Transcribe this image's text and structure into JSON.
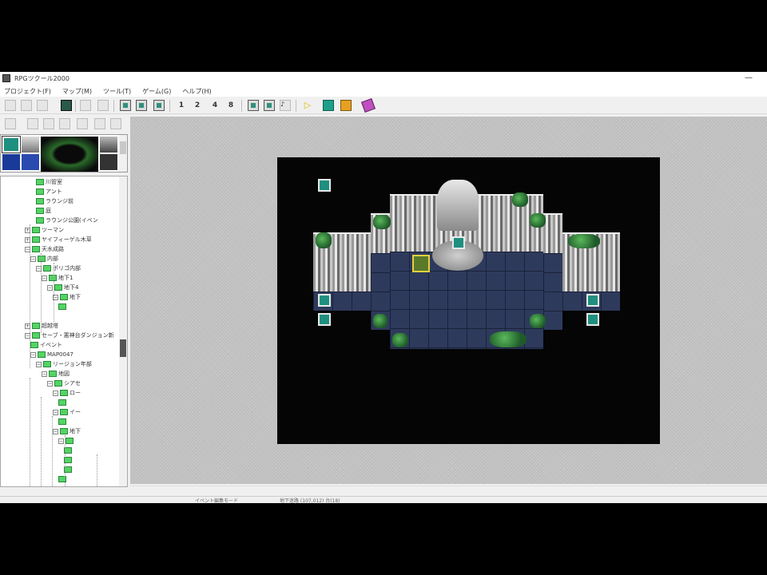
{
  "window": {
    "title": "RPGツクール2000"
  },
  "menu": [
    "プロジェクト(F)",
    "マップ(M)",
    "ツール(T)",
    "ゲーム(G)",
    "ヘルプ(H)"
  ],
  "toolbar": {
    "layer_labels": [
      "1",
      "2",
      "4",
      "8"
    ]
  },
  "tree": {
    "items": [
      {
        "label": "川管室",
        "indent": 4,
        "expand": ""
      },
      {
        "label": "アント",
        "indent": 4,
        "expand": ""
      },
      {
        "label": "ラウンジ前",
        "indent": 4,
        "expand": ""
      },
      {
        "label": "庭",
        "indent": 4,
        "expand": ""
      },
      {
        "label": "ラウンジ公園(イベン",
        "indent": 4,
        "expand": ""
      },
      {
        "label": "ツーマン",
        "indent": 2,
        "expand": "+"
      },
      {
        "label": "ヤイフィーゲル木草",
        "indent": 2,
        "expand": "+"
      },
      {
        "label": "天水成路",
        "indent": 2,
        "expand": "-"
      },
      {
        "label": "内部",
        "indent": 3,
        "expand": "-"
      },
      {
        "label": "ポリゴ内部",
        "indent": 4,
        "expand": "-"
      },
      {
        "label": "地下1",
        "indent": 5,
        "expand": "-"
      },
      {
        "label": "地下4",
        "indent": 6,
        "expand": "-"
      },
      {
        "label": "地下",
        "indent": 7,
        "expand": "-"
      },
      {
        "label": "",
        "indent": 8,
        "expand": ""
      },
      {
        "label": "",
        "indent": 0,
        "expand": ""
      },
      {
        "label": "超越塔",
        "indent": 2,
        "expand": "+"
      },
      {
        "label": "セーブ・悪神台ダンジョン新",
        "indent": 2,
        "expand": "-"
      },
      {
        "label": "イベント",
        "indent": 3,
        "expand": ""
      },
      {
        "label": "MAP0047",
        "indent": 3,
        "expand": "-"
      },
      {
        "label": "リージョン年部",
        "indent": 4,
        "expand": "-"
      },
      {
        "label": "地図",
        "indent": 5,
        "expand": "-"
      },
      {
        "label": "シアセ",
        "indent": 6,
        "expand": "-"
      },
      {
        "label": "ロー",
        "indent": 7,
        "expand": "-"
      },
      {
        "label": "",
        "indent": 8,
        "expand": ""
      },
      {
        "label": "イー",
        "indent": 7,
        "expand": "-"
      },
      {
        "label": "",
        "indent": 8,
        "expand": ""
      },
      {
        "label": "地下",
        "indent": 7,
        "expand": "-"
      },
      {
        "label": "",
        "indent": 8,
        "expand": "-"
      },
      {
        "label": "",
        "indent": 9,
        "expand": ""
      },
      {
        "label": "",
        "indent": 9,
        "expand": ""
      },
      {
        "label": "",
        "indent": 9,
        "expand": ""
      },
      {
        "label": "",
        "indent": 8,
        "expand": ""
      }
    ]
  },
  "status": {
    "mode": "イベント編集モード",
    "info": "地下迷路 (107,012) 台(18)"
  },
  "colors": {
    "event": "#1f8f80",
    "floor": "#2e3a5c",
    "folder": "#54d464"
  }
}
